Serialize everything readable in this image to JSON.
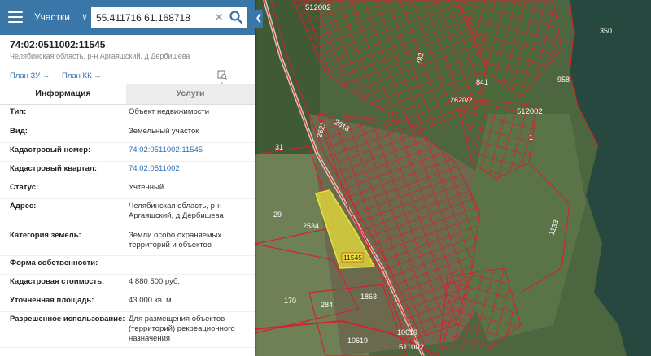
{
  "search": {
    "category": "Участки",
    "query": "55.411716 61.168718"
  },
  "object": {
    "cadastral_title": "74:02:0511002:11545",
    "address_short": "Челябинская область, р-н Аргаяшский, д Дербишева",
    "plan_zu": "План ЗУ →",
    "plan_kk": "План КК →"
  },
  "tabs": {
    "info": "Информация",
    "services": "Услуги"
  },
  "props": {
    "type": {
      "label": "Тип:",
      "value": "Объект недвижимости"
    },
    "kind": {
      "label": "Вид:",
      "value": "Земельный участок"
    },
    "cad_number": {
      "label": "Кадастровый номер:",
      "value": "74:02:0511002:11545"
    },
    "cad_quarter": {
      "label": "Кадастровый квартал:",
      "value": "74:02:0511002"
    },
    "status": {
      "label": "Статус:",
      "value": "Учтенный"
    },
    "address": {
      "label": "Адрес:",
      "value1": "Челябинская область, р-н",
      "value2": "Аргаяшский, д Дербишева"
    },
    "land_category": {
      "label": "Категория земель:",
      "value1": "Земли особо охраняемых",
      "value2": "территорий и объектов"
    },
    "ownership": {
      "label": "Форма собственности:",
      "value": "-"
    },
    "cad_cost": {
      "label": "Кадастровая стоимость:",
      "value": "4 880 500 руб."
    },
    "area": {
      "label": "Уточненная площадь:",
      "value": "43 000 кв. м"
    },
    "permitted_use": {
      "label": "Разрешенное использование:",
      "value1": "Для размещения объектов",
      "value2": "(территорий) рекреационного",
      "value3": "назначения"
    }
  },
  "map": {
    "labels": {
      "q_512002_top": "512002",
      "q_512002_mid": "512002",
      "q_511002": "511002",
      "n350": "350",
      "n958": "958",
      "n841": "841",
      "n2620": "2620/2",
      "n782": "782",
      "n2621": "2621",
      "n2618": "2618",
      "n31": "31",
      "n29": "29",
      "n2534": "2534",
      "n11545": "11545",
      "n1863": "1863",
      "n170": "170",
      "n284": "284",
      "n10619a": "10619",
      "n10619b": "10619",
      "n1": "1",
      "n1133": "1133"
    }
  },
  "colors": {
    "header": "#3b76a8",
    "link": "#2f6fb3",
    "parcel_border": "#e0202a",
    "selected_parcel": "#e8e23a",
    "water": "#27483f"
  }
}
